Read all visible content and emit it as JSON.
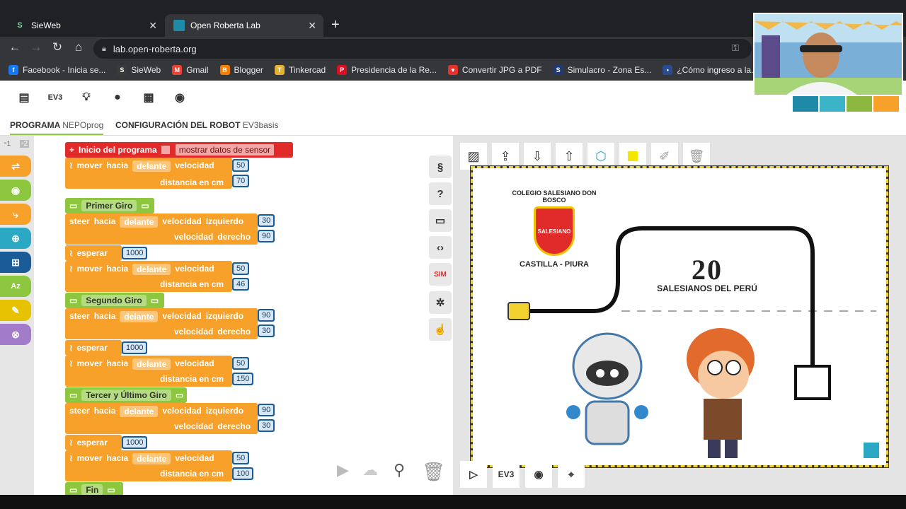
{
  "browser": {
    "tabs": [
      {
        "title": "SieWeb",
        "active": false
      },
      {
        "title": "Open Roberta Lab",
        "active": true
      }
    ],
    "url": "lab.open-roberta.org",
    "bookmarks": [
      {
        "label": "Facebook - Inicia se...",
        "color": "#1877f2",
        "icon": "f"
      },
      {
        "label": "SieWeb",
        "color": "#3a3a3a",
        "icon": "S"
      },
      {
        "label": "Gmail",
        "color": "#ea4335",
        "icon": "M"
      },
      {
        "label": "Blogger",
        "color": "#f57d00",
        "icon": "B"
      },
      {
        "label": "Tinkercad",
        "color": "#e4b231",
        "icon": "T"
      },
      {
        "label": "Presidencia de la Re...",
        "color": "#d91023",
        "icon": "P"
      },
      {
        "label": "Convertir JPG a PDF",
        "color": "#e5322d",
        "icon": "♥"
      },
      {
        "label": "Simulacro - Zona Es...",
        "color": "#1f3a73",
        "icon": "S"
      },
      {
        "label": "¿Cómo ingreso a la...",
        "color": "#2a4d8f",
        "icon": "•"
      },
      {
        "label": "De",
        "color": "#1f3a73",
        "icon": "•"
      }
    ]
  },
  "app": {
    "top_icon_ev3": "EV3",
    "tabs": {
      "program_label": "PROGRAMA",
      "program_name": "NEPOprog",
      "config_label": "CONFIGURACIÓN DEL ROBOT",
      "config_name": "EV3basis"
    },
    "page_selectors": [
      "1",
      "2"
    ],
    "blocks": {
      "start": "Inicio del programa",
      "show_sensor": "mostrar datos de sensor",
      "move": "mover",
      "toward": "hacia",
      "forward": "delante",
      "speed": "velocidad",
      "distance": "distancia en cm",
      "steer": "steer",
      "left": "izquierdo",
      "right": "derecho",
      "wait": "esperar",
      "comments": [
        "Primer Giro",
        "Segundo Giro",
        "Tercer y Último Giro",
        "Fin"
      ],
      "values": {
        "m1_speed": "50",
        "m1_dist": "70",
        "s1_left": "30",
        "s1_right": "90",
        "w1": "1000",
        "m2_speed": "50",
        "m2_dist": "46",
        "s2_left": "90",
        "s2_right": "30",
        "w2": "1000",
        "m3_speed": "50",
        "m3_dist": "150",
        "s3_left": "90",
        "s3_right": "30",
        "w3": "1000",
        "m4_speed": "50",
        "m4_dist": "100"
      }
    },
    "right_tools": {
      "sim": "SIM"
    },
    "sim": {
      "bottom_ev3": "EV3",
      "colegio_arc": "COLEGIO SALESIANO DON BOSCO",
      "colegio_shield": "SALESIANO",
      "colegio_city": "CASTILLA - PIURA",
      "salesianos_big": "20",
      "salesianos_label": "SALESIANOS DEL PERÚ"
    }
  },
  "colors": {
    "orange": "#f7a12b",
    "red": "#e12a2a",
    "green": "#8dc63f",
    "blue": "#1a5c98",
    "accent_teal": "#2aa8c4"
  }
}
